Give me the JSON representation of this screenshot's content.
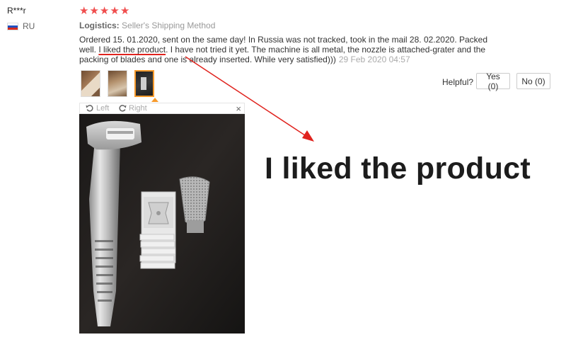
{
  "reviewer": {
    "name": "R***r",
    "country": "RU"
  },
  "rating": {
    "stars": 5,
    "star_glyph": "★",
    "color": "#f04e4e"
  },
  "logistics": {
    "label": "Logistics:",
    "value": "Seller's Shipping Method"
  },
  "review": {
    "text_before": "Ordered 15. 01.2020, sent on the same day! In Russia was not tracked, took in the mail 28. 02.2020. Packed well. ",
    "highlight": "I liked the product",
    "text_after": ". I have not tried it yet. The machine is all metal, the nozzle is attached-grater and the packing of blades and one is already inserted. While very satisfied)))",
    "date": "29 Feb 2020 04:57",
    "highlight_color": "#e0231e"
  },
  "helpful": {
    "label": "Helpful?",
    "yes_label": "Yes (0)",
    "no_label": "No (0)"
  },
  "viewer": {
    "left_label": "Left",
    "right_label": "Right",
    "close_glyph": "×"
  },
  "annotation": {
    "caption": "I liked the product",
    "arrow_color": "#e0231e"
  },
  "icons": [
    "flag-ru-icon",
    "star-icon",
    "rotate-left-icon",
    "rotate-right-icon",
    "close-icon"
  ]
}
